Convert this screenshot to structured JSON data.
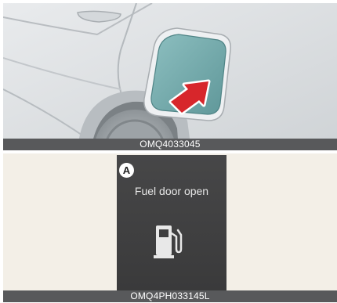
{
  "figure_top": {
    "caption": "OMQ4033045",
    "icons": [
      "fuel-door-illustration",
      "press-arrow-icon"
    ],
    "colors": {
      "door": "#6fa6a8",
      "arrow": "#d7262b",
      "body": "#dfe2e5"
    }
  },
  "figure_bottom": {
    "caption": "OMQ4PH033145L",
    "marker": "A",
    "message": "Fuel door open",
    "icons": [
      "fuel-pump-icon"
    ],
    "colors": {
      "cluster": "#3f3f40",
      "background": "#f3efe7"
    }
  }
}
